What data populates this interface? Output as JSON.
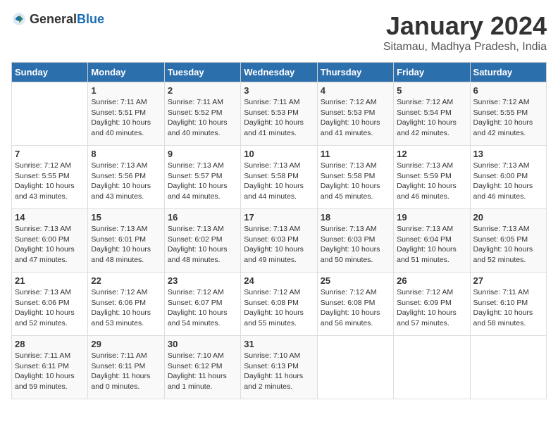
{
  "header": {
    "logo_general": "General",
    "logo_blue": "Blue",
    "month_year": "January 2024",
    "location": "Sitamau, Madhya Pradesh, India"
  },
  "days_of_week": [
    "Sunday",
    "Monday",
    "Tuesday",
    "Wednesday",
    "Thursday",
    "Friday",
    "Saturday"
  ],
  "weeks": [
    [
      {
        "day": "",
        "info": ""
      },
      {
        "day": "1",
        "info": "Sunrise: 7:11 AM\nSunset: 5:51 PM\nDaylight: 10 hours\nand 40 minutes."
      },
      {
        "day": "2",
        "info": "Sunrise: 7:11 AM\nSunset: 5:52 PM\nDaylight: 10 hours\nand 40 minutes."
      },
      {
        "day": "3",
        "info": "Sunrise: 7:11 AM\nSunset: 5:53 PM\nDaylight: 10 hours\nand 41 minutes."
      },
      {
        "day": "4",
        "info": "Sunrise: 7:12 AM\nSunset: 5:53 PM\nDaylight: 10 hours\nand 41 minutes."
      },
      {
        "day": "5",
        "info": "Sunrise: 7:12 AM\nSunset: 5:54 PM\nDaylight: 10 hours\nand 42 minutes."
      },
      {
        "day": "6",
        "info": "Sunrise: 7:12 AM\nSunset: 5:55 PM\nDaylight: 10 hours\nand 42 minutes."
      }
    ],
    [
      {
        "day": "7",
        "info": "Sunrise: 7:12 AM\nSunset: 5:55 PM\nDaylight: 10 hours\nand 43 minutes."
      },
      {
        "day": "8",
        "info": "Sunrise: 7:13 AM\nSunset: 5:56 PM\nDaylight: 10 hours\nand 43 minutes."
      },
      {
        "day": "9",
        "info": "Sunrise: 7:13 AM\nSunset: 5:57 PM\nDaylight: 10 hours\nand 44 minutes."
      },
      {
        "day": "10",
        "info": "Sunrise: 7:13 AM\nSunset: 5:58 PM\nDaylight: 10 hours\nand 44 minutes."
      },
      {
        "day": "11",
        "info": "Sunrise: 7:13 AM\nSunset: 5:58 PM\nDaylight: 10 hours\nand 45 minutes."
      },
      {
        "day": "12",
        "info": "Sunrise: 7:13 AM\nSunset: 5:59 PM\nDaylight: 10 hours\nand 46 minutes."
      },
      {
        "day": "13",
        "info": "Sunrise: 7:13 AM\nSunset: 6:00 PM\nDaylight: 10 hours\nand 46 minutes."
      }
    ],
    [
      {
        "day": "14",
        "info": "Sunrise: 7:13 AM\nSunset: 6:00 PM\nDaylight: 10 hours\nand 47 minutes."
      },
      {
        "day": "15",
        "info": "Sunrise: 7:13 AM\nSunset: 6:01 PM\nDaylight: 10 hours\nand 48 minutes."
      },
      {
        "day": "16",
        "info": "Sunrise: 7:13 AM\nSunset: 6:02 PM\nDaylight: 10 hours\nand 48 minutes."
      },
      {
        "day": "17",
        "info": "Sunrise: 7:13 AM\nSunset: 6:03 PM\nDaylight: 10 hours\nand 49 minutes."
      },
      {
        "day": "18",
        "info": "Sunrise: 7:13 AM\nSunset: 6:03 PM\nDaylight: 10 hours\nand 50 minutes."
      },
      {
        "day": "19",
        "info": "Sunrise: 7:13 AM\nSunset: 6:04 PM\nDaylight: 10 hours\nand 51 minutes."
      },
      {
        "day": "20",
        "info": "Sunrise: 7:13 AM\nSunset: 6:05 PM\nDaylight: 10 hours\nand 52 minutes."
      }
    ],
    [
      {
        "day": "21",
        "info": "Sunrise: 7:13 AM\nSunset: 6:06 PM\nDaylight: 10 hours\nand 52 minutes."
      },
      {
        "day": "22",
        "info": "Sunrise: 7:12 AM\nSunset: 6:06 PM\nDaylight: 10 hours\nand 53 minutes."
      },
      {
        "day": "23",
        "info": "Sunrise: 7:12 AM\nSunset: 6:07 PM\nDaylight: 10 hours\nand 54 minutes."
      },
      {
        "day": "24",
        "info": "Sunrise: 7:12 AM\nSunset: 6:08 PM\nDaylight: 10 hours\nand 55 minutes."
      },
      {
        "day": "25",
        "info": "Sunrise: 7:12 AM\nSunset: 6:08 PM\nDaylight: 10 hours\nand 56 minutes."
      },
      {
        "day": "26",
        "info": "Sunrise: 7:12 AM\nSunset: 6:09 PM\nDaylight: 10 hours\nand 57 minutes."
      },
      {
        "day": "27",
        "info": "Sunrise: 7:11 AM\nSunset: 6:10 PM\nDaylight: 10 hours\nand 58 minutes."
      }
    ],
    [
      {
        "day": "28",
        "info": "Sunrise: 7:11 AM\nSunset: 6:11 PM\nDaylight: 10 hours\nand 59 minutes."
      },
      {
        "day": "29",
        "info": "Sunrise: 7:11 AM\nSunset: 6:11 PM\nDaylight: 11 hours\nand 0 minutes."
      },
      {
        "day": "30",
        "info": "Sunrise: 7:10 AM\nSunset: 6:12 PM\nDaylight: 11 hours\nand 1 minute."
      },
      {
        "day": "31",
        "info": "Sunrise: 7:10 AM\nSunset: 6:13 PM\nDaylight: 11 hours\nand 2 minutes."
      },
      {
        "day": "",
        "info": ""
      },
      {
        "day": "",
        "info": ""
      },
      {
        "day": "",
        "info": ""
      }
    ]
  ]
}
